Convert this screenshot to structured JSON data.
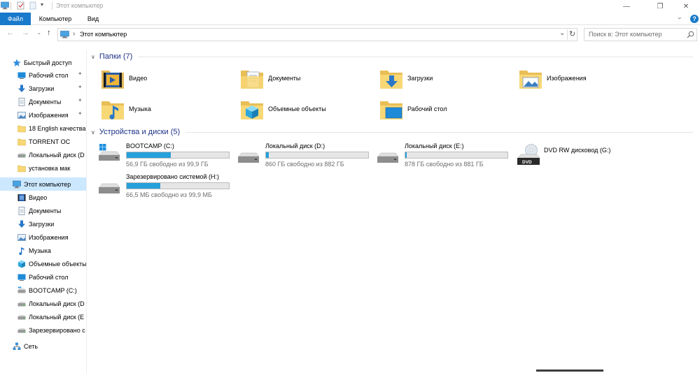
{
  "window": {
    "title": "Этот компьютер",
    "minimize": "—",
    "restore": "❐",
    "close": "✕"
  },
  "ribbon": {
    "tabs": [
      "Файл",
      "Компьютер",
      "Вид"
    ],
    "help": "?"
  },
  "addressbar": {
    "path_sep": "›",
    "path": "Этот компьютер",
    "dropdown": "⌄",
    "refresh": "↻",
    "search_placeholder": "Поиск в: Этот компьютер"
  },
  "sidebar": {
    "quick_access": {
      "label": "Быстрый доступ",
      "items": [
        {
          "label": "Рабочий стол",
          "icon": "desktop-icon",
          "pinned": true
        },
        {
          "label": "Загрузки",
          "icon": "downloads-icon",
          "pinned": true
        },
        {
          "label": "Документы",
          "icon": "documents-icon",
          "pinned": true
        },
        {
          "label": "Изображения",
          "icon": "pictures-icon",
          "pinned": true
        },
        {
          "label": "18  English качества",
          "icon": "folder-icon",
          "pinned": false
        },
        {
          "label": "TORRENT OC",
          "icon": "folder-icon",
          "pinned": false
        },
        {
          "label": "Локальный диск (D",
          "icon": "drive-icon",
          "pinned": false
        },
        {
          "label": "установка мак",
          "icon": "folder-icon",
          "pinned": false
        }
      ]
    },
    "this_pc": {
      "label": "Этот компьютер",
      "items": [
        {
          "label": "Видео",
          "icon": "video-icon"
        },
        {
          "label": "Документы",
          "icon": "documents-icon"
        },
        {
          "label": "Загрузки",
          "icon": "downloads-icon"
        },
        {
          "label": "Изображения",
          "icon": "pictures-icon"
        },
        {
          "label": "Музыка",
          "icon": "music-icon"
        },
        {
          "label": "Объемные объекты",
          "icon": "3d-objects-icon"
        },
        {
          "label": "Рабочий стол",
          "icon": "desktop-icon"
        },
        {
          "label": "BOOTCAMP (C:)",
          "icon": "system-drive-icon"
        },
        {
          "label": "Локальный диск (D",
          "icon": "drive-icon"
        },
        {
          "label": "Локальный диск (E",
          "icon": "drive-icon"
        },
        {
          "label": "Зарезервировано с",
          "icon": "drive-icon"
        }
      ]
    },
    "network": {
      "label": "Сеть",
      "icon": "network-icon"
    },
    "pin_glyph": "📌"
  },
  "main": {
    "folders_group": {
      "title": "Папки (7)",
      "items": [
        {
          "label": "Видео",
          "icon": "video-folder-icon"
        },
        {
          "label": "Документы",
          "icon": "documents-folder-icon"
        },
        {
          "label": "Загрузки",
          "icon": "downloads-folder-icon"
        },
        {
          "label": "Изображения",
          "icon": "pictures-folder-icon"
        },
        {
          "label": "Музыка",
          "icon": "music-folder-icon"
        },
        {
          "label": "Объемные объекты",
          "icon": "3d-objects-folder-icon"
        },
        {
          "label": "Рабочий стол",
          "icon": "desktop-folder-icon"
        }
      ]
    },
    "drives_group": {
      "title": "Устройства и диски (5)",
      "items": [
        {
          "label": "BOOTCAMP (C:)",
          "info": "56,9 ГБ свободно из 99,9 ГБ",
          "used_fraction": 0.43,
          "icon": "system-drive-icon"
        },
        {
          "label": "Локальный диск (D:)",
          "info": "860 ГБ свободно из 882 ГБ",
          "used_fraction": 0.025,
          "icon": "drive-icon"
        },
        {
          "label": "Локальный диск (E:)",
          "info": "878 ГБ свободно из 881 ГБ",
          "used_fraction": 0.004,
          "icon": "drive-icon"
        },
        {
          "label": "DVD RW дисковод (G:)",
          "icon": "dvd-drive-icon",
          "dvd_badge": "DVD"
        },
        {
          "label": "Зарезервировано системой (H:)",
          "info": "66,5 МБ свободно из 99,9 МБ",
          "used_fraction": 0.33,
          "icon": "drive-icon"
        }
      ]
    }
  },
  "colors": {
    "accent": "#1979ca",
    "selected": "#cce8ff",
    "group_title": "#1e3287",
    "usage_bar": "#26a0da",
    "folder_yellow": "#f8d775"
  }
}
